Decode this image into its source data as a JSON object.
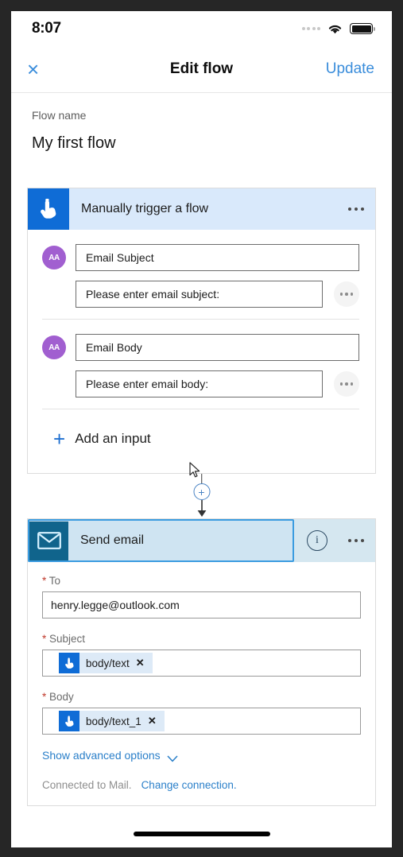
{
  "status_bar": {
    "time": "8:07",
    "signal_icon": "signal-dots-icon",
    "wifi_icon": "wifi-icon",
    "battery_icon": "battery-full-icon"
  },
  "navbar": {
    "close_icon": "close-icon",
    "close_label": "×",
    "title": "Edit flow",
    "update_label": "Update"
  },
  "flow_name": {
    "label": "Flow name",
    "value": "My first flow"
  },
  "trigger_card": {
    "icon": "manual-trigger-hand-icon",
    "title": "Manually trigger a flow",
    "overflow_icon": "more-options-icon",
    "inputs": [
      {
        "avatar_icon": "text-type-icon",
        "avatar_label": "AA",
        "name": "Email Subject",
        "prompt": "Please enter email subject:",
        "overflow_icon": "more-options-icon"
      },
      {
        "avatar_icon": "text-type-icon",
        "avatar_label": "AA",
        "name": "Email Body",
        "prompt": "Please enter email body:",
        "overflow_icon": "more-options-icon"
      }
    ],
    "add_input_plus": "+",
    "add_input_label": "Add an input"
  },
  "connector": {
    "add_step_icon": "add-step-plus-icon",
    "add_step_label": "+",
    "arrow_icon": "arrow-down-icon"
  },
  "action_card": {
    "icon": "envelope-icon",
    "title": "Send email",
    "info_icon": "info-icon",
    "info_label": "i",
    "overflow_icon": "more-options-icon",
    "selected": true,
    "fields": [
      {
        "required_mark": "*",
        "label": "To",
        "value": "henry.legge@outlook.com",
        "type": "text"
      },
      {
        "required_mark": "*",
        "label": "Subject",
        "token_icon": "manual-trigger-hand-icon",
        "token_label": "body/text",
        "token_remove": "✕",
        "type": "token"
      },
      {
        "required_mark": "*",
        "label": "Body",
        "token_icon": "manual-trigger-hand-icon",
        "token_label": "body/text_1",
        "token_remove": "✕",
        "type": "token"
      }
    ],
    "advanced_label": "Show advanced options",
    "advanced_chevron_icon": "chevron-down-icon",
    "connection_text": "Connected to Mail.",
    "connection_link": "Change connection."
  },
  "colors": {
    "accent_blue": "#0f6cd6",
    "link_blue": "#2a7fc9",
    "nav_blue": "#3a8ddb",
    "trigger_header_bg": "#d9e9fb",
    "action_header_bg": "#d5e7f0",
    "teal_icon_bg": "#10648c",
    "avatar_purple": "#a15fd0",
    "required_red": "#c0392b",
    "selection_border": "#3b9ce0"
  },
  "home_indicator": "home-indicator"
}
